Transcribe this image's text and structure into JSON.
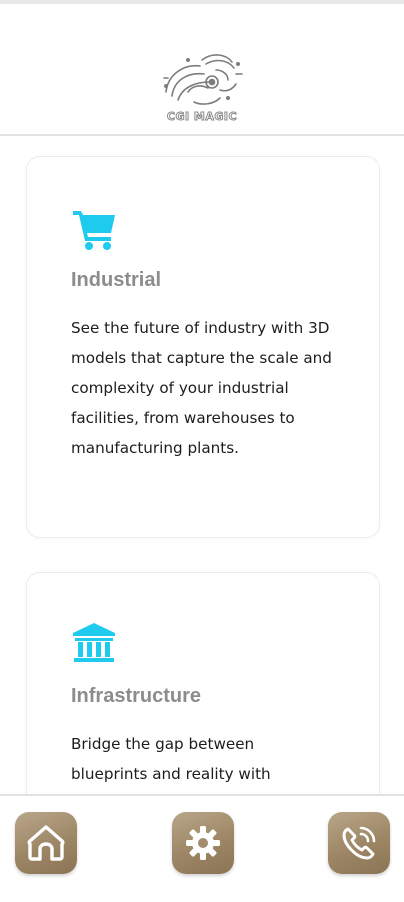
{
  "header": {
    "logo_text": "CGI MAGIC"
  },
  "cards": [
    {
      "icon": "shopping-cart-icon",
      "title": "Industrial",
      "text": "See the future of industry with 3D models that capture the scale and complexity of your industrial facilities, from warehouses to manufacturing plants."
    },
    {
      "icon": "building-columns-icon",
      "title": "Infrastructure",
      "text": "Bridge the gap between blueprints and reality with"
    }
  ],
  "bottom_nav": {
    "items": [
      {
        "icon": "home-icon"
      },
      {
        "icon": "gear-icon"
      },
      {
        "icon": "phone-icon"
      }
    ]
  },
  "colors": {
    "accent_icon": "#1ecbee",
    "nav_button": "#a38d6d",
    "title_text": "#8c8c8c",
    "body_text": "#1d1d1d"
  }
}
